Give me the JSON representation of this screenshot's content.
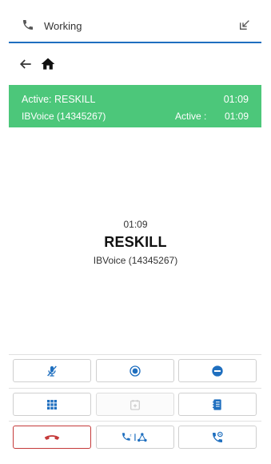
{
  "header": {
    "status_label": "Working",
    "phone_icon": "phone-icon",
    "popout_icon": "popout-icon"
  },
  "nav": {
    "back_icon": "back-arrow-icon",
    "home_icon": "home-icon"
  },
  "active_call": {
    "title": "Active: RESKILL",
    "title_time": "01:09",
    "line": "IBVoice (14345267)",
    "status_label": "Active :",
    "status_time": "01:09",
    "color": "#4cc77a"
  },
  "call": {
    "timer": "01:09",
    "name": "RESKILL",
    "line": "IBVoice (14345267)"
  },
  "controls": [
    {
      "icon": "mute-microphone-icon"
    },
    {
      "icon": "record-icon"
    },
    {
      "icon": "do-not-disturb-icon"
    },
    {
      "icon": "dialpad-icon"
    },
    {
      "icon": "calendar-add-icon",
      "disabled": true
    },
    {
      "icon": "address-book-icon"
    },
    {
      "icon": "hang-up-icon"
    },
    {
      "icon": "transfer-conference-icon"
    },
    {
      "icon": "consult-call-icon"
    }
  ],
  "colors": {
    "accent": "#1f6fbf",
    "active_green": "#4cc77a",
    "hangup_red": "#c53a3a"
  }
}
